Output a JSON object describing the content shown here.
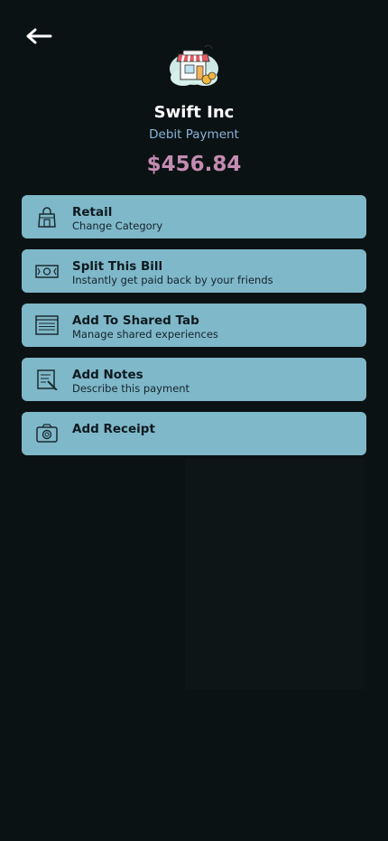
{
  "merchant": {
    "name": "Swift Inc",
    "payment_type": "Debit Payment",
    "amount": "$456.84"
  },
  "actions": [
    {
      "icon": "shopping-bag-icon",
      "title": "Retail",
      "subtitle": "Change Category"
    },
    {
      "icon": "cash-icon",
      "title": "Split This Bill",
      "subtitle": "Instantly get paid back by your friends"
    },
    {
      "icon": "list-icon",
      "title": "Add To Shared Tab",
      "subtitle": "Manage shared experiences"
    },
    {
      "icon": "note-pencil-icon",
      "title": "Add Notes",
      "subtitle": "Describe this payment"
    },
    {
      "icon": "camera-icon",
      "title": "Add Receipt",
      "subtitle": ""
    }
  ],
  "colors": {
    "background": "#0b1214",
    "card": "#7fb8c9",
    "amount": "#c48cb2",
    "payment_type": "#8ab4d8"
  }
}
